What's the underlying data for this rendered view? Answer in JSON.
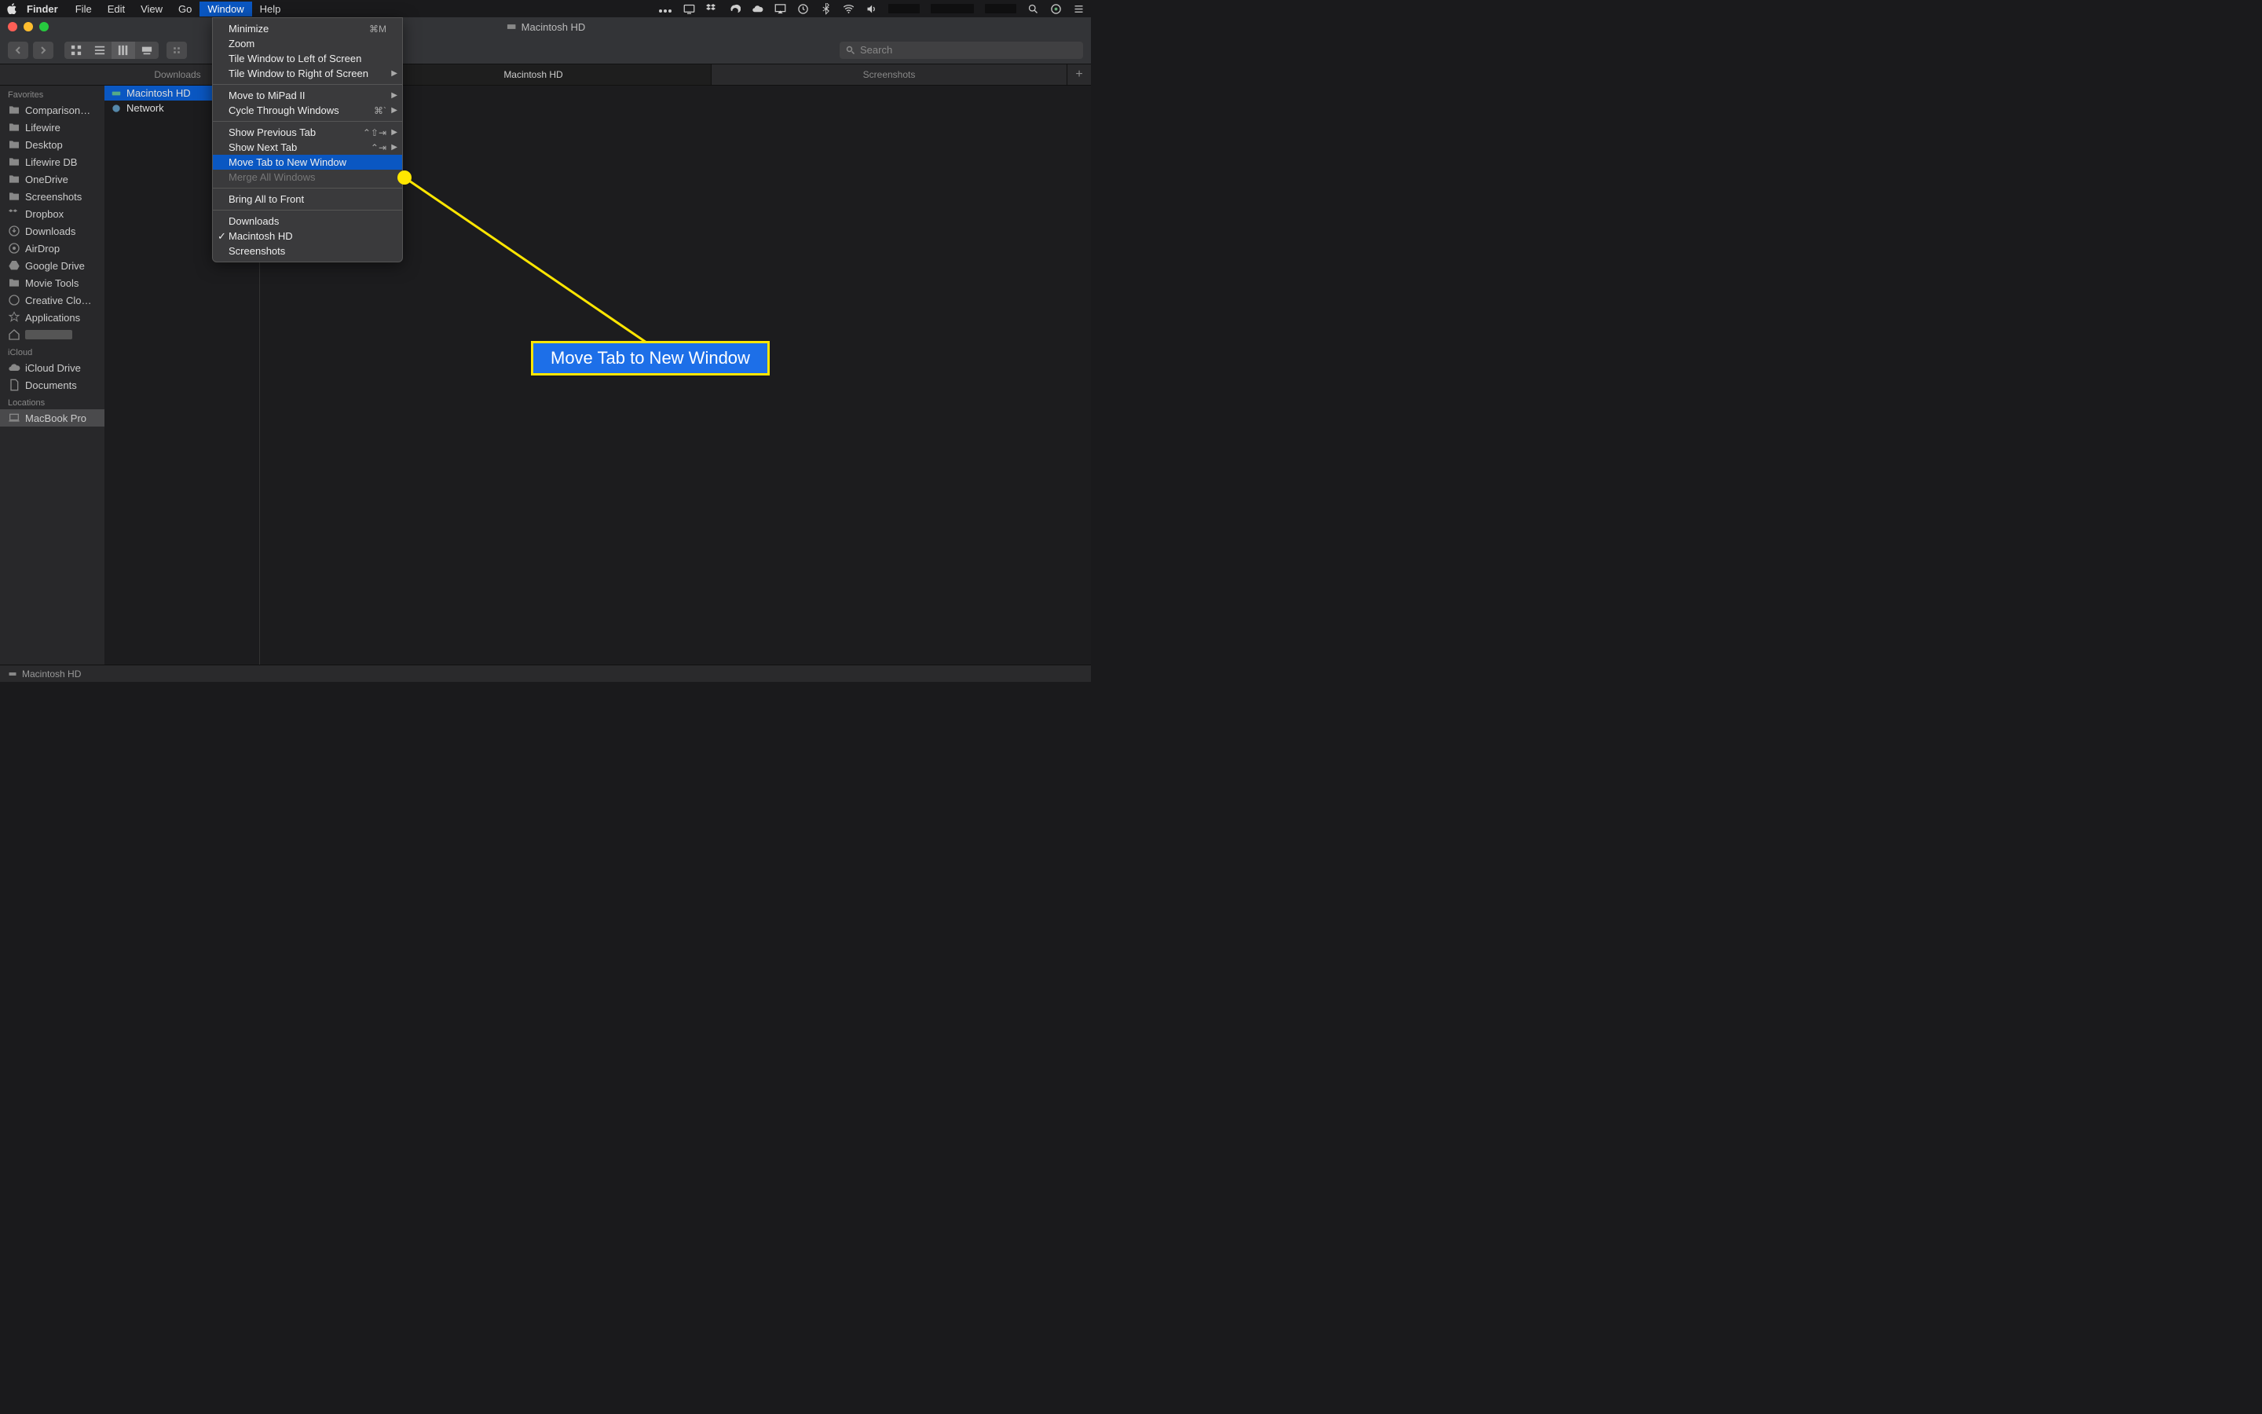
{
  "menubar": {
    "app": "Finder",
    "items": [
      "File",
      "Edit",
      "View",
      "Go",
      "Window",
      "Help"
    ],
    "active": "Window"
  },
  "dropdown": {
    "groups": [
      [
        {
          "label": "Minimize",
          "shortcut": "⌘M"
        },
        {
          "label": "Zoom"
        },
        {
          "label": "Tile Window to Left of Screen"
        },
        {
          "label": "Tile Window to Right of Screen"
        }
      ],
      [
        {
          "label": "Move to MiPad II",
          "submenu": true
        },
        {
          "label": "Cycle Through Windows",
          "shortcut": "⌘`",
          "submenu": true
        }
      ],
      [
        {
          "label": "Show Previous Tab",
          "shortcut": "⌃⇧⇥",
          "submenu": true
        },
        {
          "label": "Show Next Tab",
          "shortcut": "⌃⇥",
          "submenu": true
        },
        {
          "label": "Move Tab to New Window",
          "highlighted": true
        },
        {
          "label": "Merge All Windows",
          "disabled": true
        }
      ],
      [
        {
          "label": "Bring All to Front"
        }
      ],
      [
        {
          "label": "Downloads"
        },
        {
          "label": "Macintosh HD",
          "checked": true
        },
        {
          "label": "Screenshots"
        }
      ]
    ]
  },
  "window": {
    "title": "Macintosh HD",
    "search_placeholder": "Search",
    "tabs": [
      "Downloads",
      "Macintosh HD",
      "Screenshots"
    ],
    "active_tab": "Macintosh HD",
    "path": "Macintosh HD"
  },
  "sidebar": {
    "favorites_header": "Favorites",
    "favorites": [
      "Comparison…",
      "Lifewire",
      "Desktop",
      "Lifewire DB",
      "OneDrive",
      "Screenshots",
      "Dropbox",
      "Downloads",
      "AirDrop",
      "Google Drive",
      "Movie Tools",
      "Creative Clo…",
      "Applications",
      ""
    ],
    "icloud_header": "iCloud",
    "icloud": [
      "iCloud Drive",
      "Documents"
    ],
    "locations_header": "Locations",
    "locations": [
      "MacBook Pro"
    ]
  },
  "column1": [
    {
      "label": "Macintosh HD",
      "selected": true,
      "icon": "drive"
    },
    {
      "label": "Network",
      "icon": "globe"
    }
  ],
  "callout": {
    "text": "Move Tab to New Window"
  }
}
